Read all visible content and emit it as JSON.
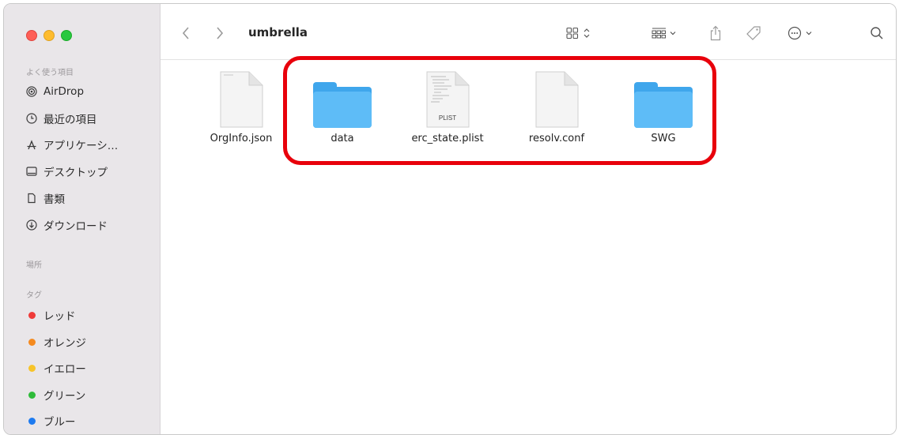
{
  "window": {
    "title": "umbrella",
    "view_icon": "icon-grid-view-icon",
    "group_icon": "group-by-icon",
    "share_icon": "share-icon",
    "tag_icon": "tag-icon",
    "more_icon": "more-actions-icon",
    "search_icon": "search-icon"
  },
  "sidebar": {
    "favorites_header": "よく使う項目",
    "favorites": [
      {
        "label": "AirDrop",
        "icon": "airdrop-icon"
      },
      {
        "label": "最近の項目",
        "icon": "clock-icon"
      },
      {
        "label": "アプリケーシ…",
        "icon": "applications-icon"
      },
      {
        "label": "デスクトップ",
        "icon": "desktop-icon"
      },
      {
        "label": "書類",
        "icon": "document-icon"
      },
      {
        "label": "ダウンロード",
        "icon": "download-icon"
      }
    ],
    "locations_header": "場所",
    "tags_header": "タグ",
    "tags": [
      {
        "label": "レッド",
        "color": "#ef3b39"
      },
      {
        "label": "オレンジ",
        "color": "#f58a1f"
      },
      {
        "label": "イエロー",
        "color": "#f7c42a"
      },
      {
        "label": "グリーン",
        "color": "#2fbb3a"
      },
      {
        "label": "ブルー",
        "color": "#1e7bf0"
      }
    ]
  },
  "files": [
    {
      "name": "OrgInfo.json",
      "kind": "document"
    },
    {
      "name": "data",
      "kind": "folder"
    },
    {
      "name": "erc_state.plist",
      "kind": "plist",
      "badge": "PLIST"
    },
    {
      "name": "resolv.conf",
      "kind": "document"
    },
    {
      "name": "SWG",
      "kind": "folder"
    }
  ],
  "colors": {
    "highlight": "#e8000b",
    "folder": "#5ebcf7",
    "sidebar_bg": "#e9e6e9"
  }
}
